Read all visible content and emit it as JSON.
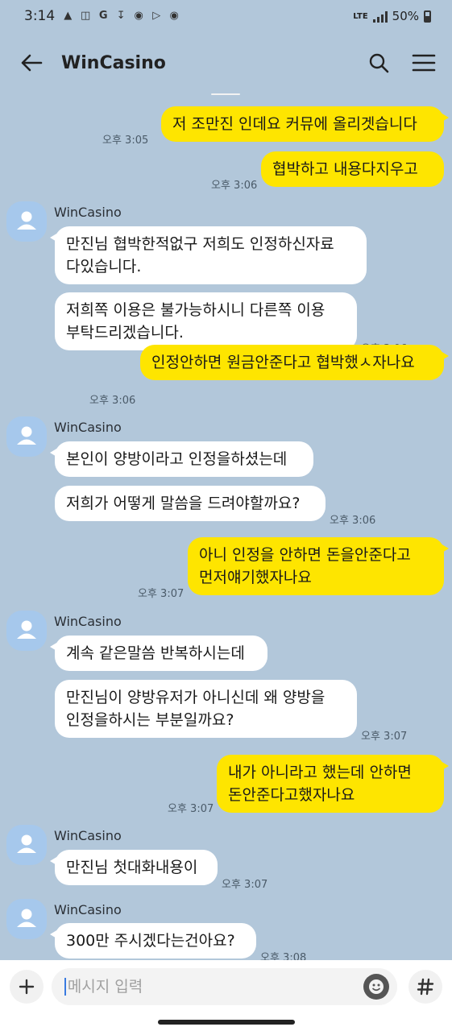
{
  "status_bar": {
    "time": "3:14",
    "battery": "50%",
    "network": "LTE"
  },
  "header": {
    "title": "WinCasino"
  },
  "messages": [
    {
      "type": "me",
      "text": "저 조만진 인데요  커뮤에  올리겟습니다",
      "time": "오후 3:05"
    },
    {
      "type": "me",
      "text": "협박하고  내용다지우고",
      "time": "오후 3:06"
    },
    {
      "type": "sender",
      "name": "WinCasino"
    },
    {
      "type": "them",
      "text": "만진님 협박한적없구 저희도 인정하신자료\n다있습니다."
    },
    {
      "type": "them",
      "text": "저희쪽 이용은 불가능하시니 다른쪽 이용\n부탁드리겠습니다.",
      "time": "오후 3:06"
    },
    {
      "type": "me",
      "text": "인정안하면 원금안준다고 협박했ㅅ자나요",
      "time": "오후 3:06"
    },
    {
      "type": "sender",
      "name": "WinCasino"
    },
    {
      "type": "them",
      "text": "본인이 양방이라고 인정을하셨는데"
    },
    {
      "type": "them",
      "text": "저희가 어떻게 말씀을 드려야할까요?",
      "time": "오후 3:06"
    },
    {
      "type": "me",
      "text": "아니 인정을 안하면 돈을안준다고\n먼저얘기했자나요",
      "time": "오후 3:07"
    },
    {
      "type": "sender",
      "name": "WinCasino"
    },
    {
      "type": "them",
      "text": "계속 같은말씀 반복하시는데"
    },
    {
      "type": "them",
      "text": "만진님이 양방유저가 아니신데 왜 양방을\n인정을하시는 부분일까요?",
      "time": "오후 3:07"
    },
    {
      "type": "me",
      "text": "내가  아니라고 했는데 안하면\n돈안준다고했자나요",
      "time": "오후 3:07"
    },
    {
      "type": "sender",
      "name": "WinCasino"
    },
    {
      "type": "them",
      "text": "만진님 첫대화내용이",
      "time": "오후 3:07"
    },
    {
      "type": "sender",
      "name": "WinCasino"
    },
    {
      "type": "them",
      "text": "300만 주시겠다는건아요?",
      "time": "오후 3:08"
    }
  ],
  "input": {
    "placeholder": "메시지 입력"
  },
  "colors": {
    "chat_background": "#b2c7da",
    "my_bubble": "#fee500",
    "their_bubble": "#ffffff",
    "avatar": "#a6c8ec"
  },
  "icons": {
    "back": "arrow-left-icon",
    "search": "search-icon",
    "menu": "hamburger-menu-icon",
    "attach": "plus-icon",
    "emoji": "emoji-icon",
    "hashtag": "hash-icon"
  }
}
